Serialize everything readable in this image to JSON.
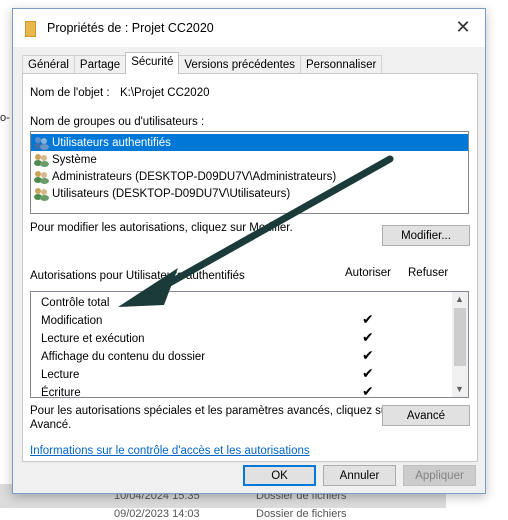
{
  "background": {
    "left_fragment": "o-",
    "rows": [
      {
        "date": "10/04/2024 15:35",
        "type": "Dossier de fichiers"
      },
      {
        "date": "09/02/2023 14:03",
        "type": "Dossier de fichiers"
      }
    ]
  },
  "dialog": {
    "title": "Propriétés de : Projet CC2020",
    "tabs": [
      "Général",
      "Partage",
      "Sécurité",
      "Versions précédentes",
      "Personnaliser"
    ],
    "active_tab": "Sécurité",
    "object_name_label": "Nom de l'objet :",
    "object_name_value": "K:\\Projet CC2020",
    "groups_label": "Nom de groupes ou d'utilisateurs :",
    "groups": [
      {
        "name": "Utilisateurs authentifiés",
        "selected": true
      },
      {
        "name": "Système",
        "selected": false
      },
      {
        "name": "Administrateurs (DESKTOP-D09DU7V\\Administrateurs)",
        "selected": false
      },
      {
        "name": "Utilisateurs (DESKTOP-D09DU7V\\Utilisateurs)",
        "selected": false
      }
    ],
    "modify_hint": "Pour modifier les autorisations, cliquez sur Modifier.",
    "modify_button": "Modifier...",
    "permissions_label": "Autorisations pour Utilisateurs authentifiés",
    "allow_header": "Autoriser",
    "deny_header": "Refuser",
    "permissions": [
      {
        "name": "Contrôle total",
        "allow": false
      },
      {
        "name": "Modification",
        "allow": true
      },
      {
        "name": "Lecture et exécution",
        "allow": true
      },
      {
        "name": "Affichage du contenu du dossier",
        "allow": true
      },
      {
        "name": "Lecture",
        "allow": true
      },
      {
        "name": "Écriture",
        "allow": true
      }
    ],
    "check_mark": "✔",
    "advanced_hint_line1": "Pour les autorisations spéciales et les paramètres avancés, cliquez sur",
    "advanced_hint_line2": "Avancé.",
    "advanced_button": "Avancé",
    "info_link": "Informations sur le contrôle d'accès et les autorisations",
    "ok_button": "OK",
    "cancel_button": "Annuler",
    "apply_button": "Appliquer",
    "icons": {
      "folder": "folder-icon",
      "close": "close-icon",
      "users": "users-icon",
      "scroll_up": "chevron-up-icon",
      "scroll_down": "chevron-down-icon"
    },
    "colors": {
      "selection": "#0078d7",
      "link": "#0066cc",
      "annotation_arrow": "#1b3a3a"
    }
  }
}
